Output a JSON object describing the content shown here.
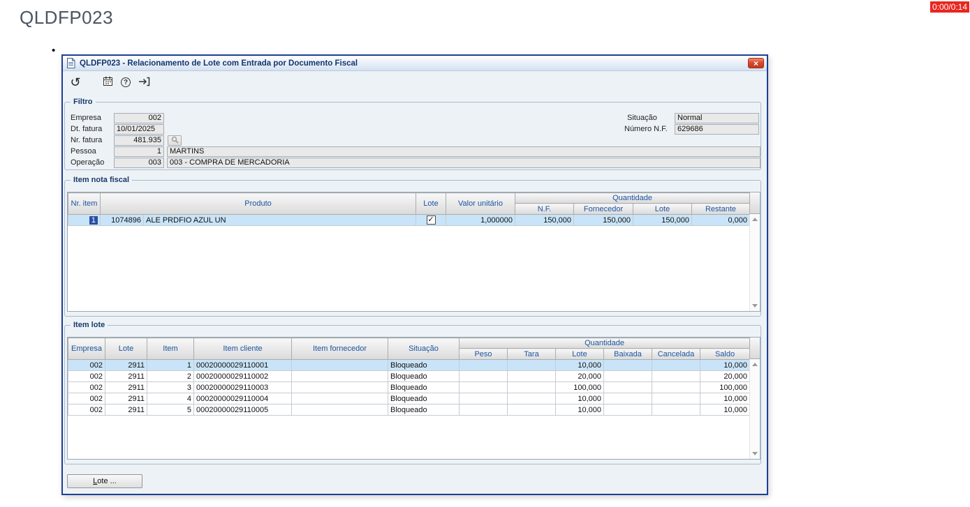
{
  "page": {
    "title": "QLDFP023",
    "timer": "0:00/0:14",
    "bullet": "•"
  },
  "titlebar": {
    "title": "QLDFP023 - Relacionamento de Lote com Entrada por Documento Fiscal"
  },
  "icons": {
    "undo": "↺",
    "help": "?",
    "close": "×",
    "check": "✓",
    "calendar": "svg-calendar",
    "exit": "svg-exit-arrow",
    "document": "svg-document",
    "lookup": "svg-magnifier",
    "scroll_up": "triangle-up",
    "scroll_down": "triangle-down"
  },
  "filtro": {
    "legend": "Filtro",
    "labels": {
      "empresa": "Empresa",
      "dt_fatura": "Dt. fatura",
      "nr_fatura": "Nr. fatura",
      "pessoa": "Pessoa",
      "operacao": "Operação",
      "situacao": "Situação",
      "numero_nf": "Número N.F."
    },
    "values": {
      "empresa": "002",
      "dt_fatura": "10/01/2025",
      "nr_fatura": "481.935",
      "pessoa": "1",
      "pessoa_nome": "MARTINS",
      "operacao": "003",
      "operacao_desc": "003 - COMPRA DE MERCADORIA",
      "situacao": "Normal",
      "numero_nf": "629686"
    }
  },
  "item_nota_fiscal": {
    "legend": "Item nota fiscal",
    "headers": {
      "nr_item": "Nr. item",
      "produto": "Produto",
      "lote": "Lote",
      "valor_unitario": "Valor unitário",
      "quantidade": "Quantidade",
      "nf": "N.F.",
      "fornecedor": "Fornecedor",
      "lote_qtd": "Lote",
      "restante": "Restante"
    },
    "rows": [
      {
        "nr_item": "1",
        "produto_codigo": "1074896",
        "produto_descricao": "ALE PRDFIO AZUL UN",
        "lote_marcado": true,
        "valor_unitario": "1,000000",
        "qtd_nf": "150,000",
        "qtd_fornecedor": "150,000",
        "qtd_lote": "150,000",
        "qtd_restante": "0,000"
      }
    ]
  },
  "item_lote": {
    "legend": "Item lote",
    "headers": {
      "empresa": "Empresa",
      "lote": "Lote",
      "item": "Item",
      "item_cliente": "Item cliente",
      "item_fornecedor": "Item fornecedor",
      "situacao": "Situação",
      "quantidade": "Quantidade",
      "peso": "Peso",
      "tara": "Tara",
      "lote_qtd": "Lote",
      "baixada": "Baixada",
      "cancelada": "Cancelada",
      "saldo": "Saldo"
    },
    "rows": [
      [
        "002",
        "2911",
        "1",
        "00020000029110001",
        "",
        "Bloqueado",
        "",
        "",
        "10,000",
        "",
        "",
        "10,000"
      ],
      [
        "002",
        "2911",
        "2",
        "00020000029110002",
        "",
        "Bloqueado",
        "",
        "",
        "20,000",
        "",
        "",
        "20,000"
      ],
      [
        "002",
        "2911",
        "3",
        "00020000029110003",
        "",
        "Bloqueado",
        "",
        "",
        "100,000",
        "",
        "",
        "100,000"
      ],
      [
        "002",
        "2911",
        "4",
        "00020000029110004",
        "",
        "Bloqueado",
        "",
        "",
        "10,000",
        "",
        "",
        "10,000"
      ],
      [
        "002",
        "2911",
        "5",
        "00020000029110005",
        "",
        "Bloqueado",
        "",
        "",
        "10,000",
        "",
        "",
        "10,000"
      ]
    ]
  },
  "footer": {
    "lote_accesskey": "L",
    "lote_label_rest": "ote ..."
  }
}
